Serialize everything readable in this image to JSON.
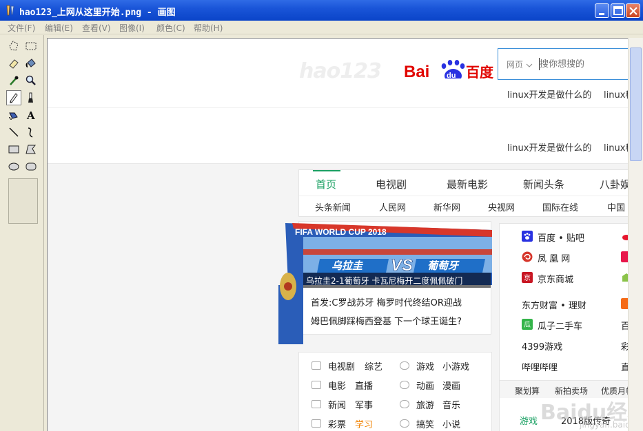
{
  "window": {
    "title": "hao123_上网从这里开始.png - 画图",
    "app_icon": "paint-icon",
    "controls": [
      "minimize-icon",
      "maximize-icon",
      "close-icon"
    ]
  },
  "menu": [
    "文件(F)",
    "编辑(E)",
    "查看(V)",
    "图像(I)",
    "颜色(C)",
    "帮助(H)"
  ],
  "tools": [
    "free-select-icon",
    "rect-select-icon",
    "eraser-icon",
    "fill-icon",
    "color-picker-icon",
    "magnifier-icon",
    "pencil-icon",
    "brush-icon",
    "airbrush-icon",
    "text-icon",
    "line-icon",
    "curve-icon",
    "rectangle-icon",
    "polygon-icon",
    "ellipse-icon",
    "rounded-rect-icon"
  ],
  "page": {
    "hao_logo": "hao123",
    "baidu_logo": "Bai百度",
    "baidu_du": "du",
    "search": {
      "category": "网页",
      "placeholder": "搜你想搜的"
    },
    "hotwords_top": [
      "linux开发是做什么的",
      "linux程"
    ],
    "hotwords_mid": [
      "linux开发是做什么的",
      "linux程"
    ],
    "nav_tabs": [
      "首页",
      "电视剧",
      "最新电影",
      "新闻头条",
      "八卦娱"
    ],
    "nav_sub": [
      "头条新闻",
      "人民网",
      "新华网",
      "央视网",
      "国际在线",
      "中国"
    ],
    "banner": {
      "header": "FIFA WORLD CUP 2018",
      "left_team": "乌拉圭",
      "vs": "VS",
      "right_team": "葡萄牙",
      "caption": "乌拉圭2-1葡萄牙 卡瓦尼梅开二度佩佩破门"
    },
    "news_lines": [
      "首发:C罗战苏牙   梅罗时代终结OR迎战",
      "姆巴佩脚踩梅西登基   下一个球王诞生?"
    ],
    "sites": [
      {
        "name": "百度 • 贴吧",
        "icon": "baidu-paw-icon"
      },
      {
        "name": "凤 凰 网",
        "icon": "phoenix-icon"
      },
      {
        "name": "京东商城",
        "icon": "jd-icon"
      },
      {
        "name": "东方财富 • 理财",
        "icon": ""
      },
      {
        "name": "瓜子二手车",
        "icon": "guazi-icon"
      },
      {
        "name": "4399游戏",
        "icon": ""
      },
      {
        "name": "哔哩哔哩",
        "icon": ""
      }
    ],
    "sites_right_partial": [
      "百",
      "彩",
      "直"
    ],
    "site_strip": [
      "聚划算",
      "新拍卖场",
      "优质月帖"
    ],
    "game_link": "游戏",
    "game_title": "2018版传奇",
    "categories": [
      [
        "电视剧",
        "综艺",
        "游戏",
        "小游戏"
      ],
      [
        "电影",
        "直播",
        "动画",
        "漫画"
      ],
      [
        "新闻",
        "军事",
        "旅游",
        "音乐"
      ],
      [
        "彩票",
        "学习",
        "搞笑",
        "小说"
      ]
    ],
    "watermark": "Baidu经验",
    "watermark_url": "jingyan.baidu.com"
  }
}
